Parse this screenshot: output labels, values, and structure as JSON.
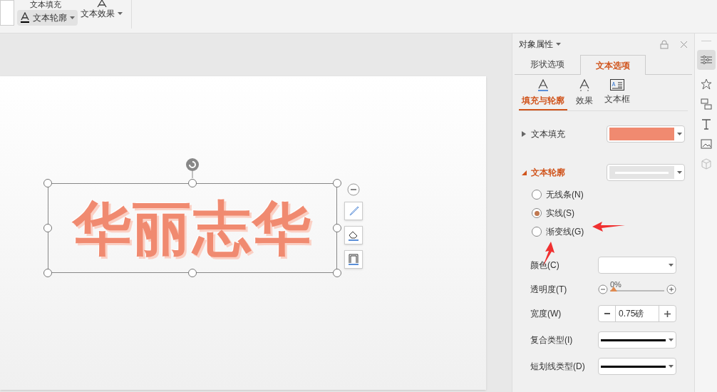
{
  "ribbon": {
    "items": [
      {
        "label": "文本填充",
        "kind": "fill"
      },
      {
        "label": "文本轮廓",
        "kind": "outline"
      },
      {
        "label": "文本效果",
        "kind": "effect"
      }
    ]
  },
  "slide": {
    "art_text": "华丽志华"
  },
  "panel": {
    "title": "对象属性",
    "tabs": [
      {
        "label": "形状选项",
        "selected": false
      },
      {
        "label": "文本选项",
        "selected": true
      }
    ],
    "subtabs": [
      {
        "label": "填充与轮廓",
        "selected": true,
        "kind": "fill"
      },
      {
        "label": "效果",
        "selected": false,
        "kind": "effect"
      },
      {
        "label": "文本框",
        "selected": false,
        "kind": "box"
      }
    ],
    "fill": {
      "label": "文本填充",
      "expanded": false,
      "color": "#f08a70"
    },
    "outline": {
      "label": "文本轮廓",
      "expanded": true,
      "options": [
        {
          "label": "无线条(N)",
          "selected": false
        },
        {
          "label": "实线(S)",
          "selected": true
        },
        {
          "label": "渐变线(G)",
          "selected": false
        }
      ],
      "color_label": "颜色(C)",
      "transparency_label": "透明度(T)",
      "transparency": {
        "reading": "0%",
        "level": 0
      },
      "width_label": "宽度(W)",
      "width_value": "0.75磅",
      "compound_label": "复合类型(I)",
      "dash_label": "短划线类型(D)"
    }
  }
}
